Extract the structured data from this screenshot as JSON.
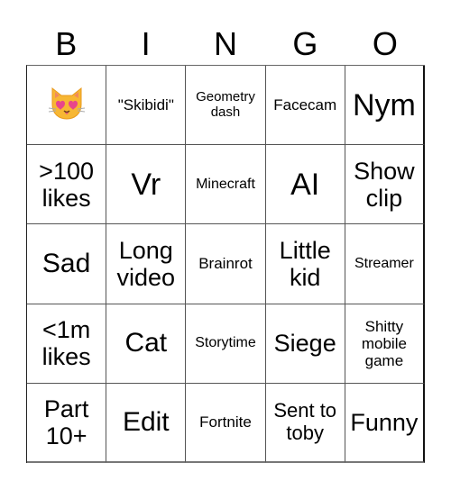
{
  "header": {
    "letters": [
      "B",
      "I",
      "N",
      "G",
      "O"
    ]
  },
  "grid": {
    "rows": [
      [
        {
          "text": "",
          "icon": "smiling-cat-heart-eyes-icon"
        },
        {
          "text": "\"Skibidi\""
        },
        {
          "text": "Geometry dash"
        },
        {
          "text": "Facecam"
        },
        {
          "text": "Nym"
        }
      ],
      [
        {
          "text": ">100 likes"
        },
        {
          "text": "Vr"
        },
        {
          "text": "Minecraft"
        },
        {
          "text": "AI"
        },
        {
          "text": "Show clip"
        }
      ],
      [
        {
          "text": "Sad"
        },
        {
          "text": "Long video"
        },
        {
          "text": "Brainrot"
        },
        {
          "text": "Little kid"
        },
        {
          "text": "Streamer"
        }
      ],
      [
        {
          "text": "<1m likes"
        },
        {
          "text": "Cat"
        },
        {
          "text": "Storytime"
        },
        {
          "text": "Siege"
        },
        {
          "text": "Shitty mobile game"
        }
      ],
      [
        {
          "text": "Part 10+"
        },
        {
          "text": "Edit"
        },
        {
          "text": "Fortnite"
        },
        {
          "text": "Sent to toby"
        },
        {
          "text": "Funny"
        }
      ]
    ]
  }
}
